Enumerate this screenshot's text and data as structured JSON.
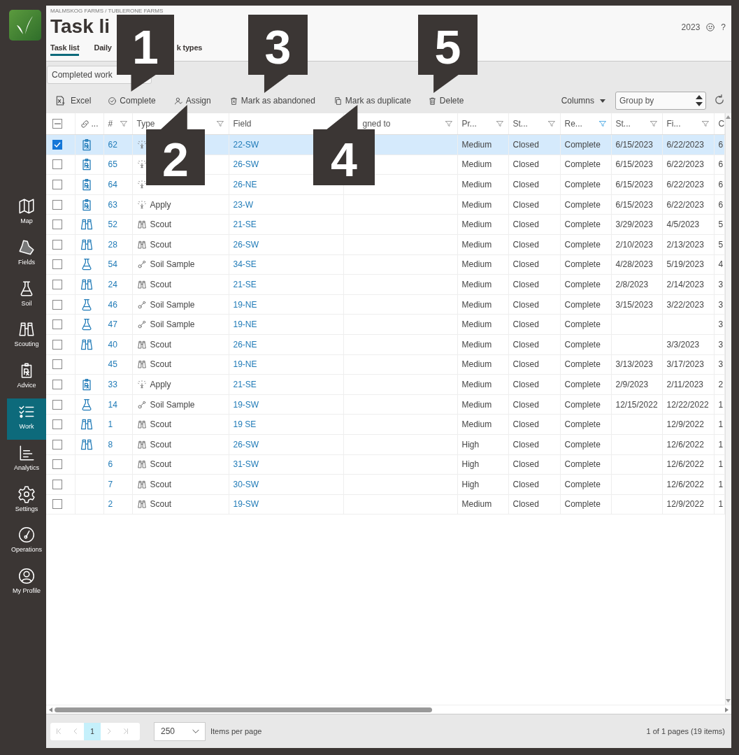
{
  "sidebar": {
    "items": [
      {
        "label": "Map",
        "kind": "map",
        "selected": false
      },
      {
        "label": "Fields",
        "kind": "fields",
        "selected": false
      },
      {
        "label": "Soil",
        "kind": "flask",
        "selected": false
      },
      {
        "label": "Scouting",
        "kind": "binoculars",
        "selected": false
      },
      {
        "label": "Advice",
        "kind": "rx",
        "selected": false
      },
      {
        "label": "Work",
        "kind": "checklist",
        "selected": true
      },
      {
        "label": "Analytics",
        "kind": "chart",
        "selected": false
      },
      {
        "label": "Settings",
        "kind": "gear",
        "selected": false
      },
      {
        "label": "Operations",
        "kind": "gauge",
        "selected": false
      },
      {
        "label": "My Profile",
        "kind": "profile",
        "selected": false
      }
    ]
  },
  "header": {
    "breadcrumb": "MALMSKOG FARMS / TUBLERONE FARMS",
    "title": "Task li",
    "year": "2023",
    "help": "?",
    "tabs": [
      {
        "label": "Task list",
        "selected": true
      },
      {
        "label": "Daily",
        "selected": false
      },
      {
        "label": "k types",
        "selected": false
      }
    ]
  },
  "view_select": {
    "value": "Completed work"
  },
  "toolbar": {
    "actions": [
      {
        "label": "Excel",
        "kind": "excel"
      },
      {
        "label": "Complete",
        "kind": "complete"
      },
      {
        "label": "Assign",
        "kind": "assign"
      },
      {
        "label": "Mark as abandoned",
        "kind": "abandon"
      },
      {
        "label": "Mark as duplicate",
        "kind": "duplicate"
      },
      {
        "label": "Delete",
        "kind": "delete"
      }
    ],
    "columns_menu": "Columns",
    "group_by": {
      "placeholder": "Group by"
    }
  },
  "table": {
    "select_all_partial": true,
    "columns": [
      {
        "label": "...",
        "kind": "link"
      },
      {
        "label": "#",
        "filter_active": false
      },
      {
        "label": "Type",
        "filter_active": false
      },
      {
        "label": "Field"
      },
      {
        "label": "gned to",
        "filter_active": false
      },
      {
        "label": "Pr...",
        "filter_active": false
      },
      {
        "label": "St...",
        "filter_active": false
      },
      {
        "label": "Re...",
        "filter_active": true
      },
      {
        "label": "St...",
        "filter_active": false
      },
      {
        "label": "Fi...",
        "filter_active": false
      },
      {
        "label": "C",
        "kind": "cut"
      }
    ],
    "rows": [
      {
        "selected": true,
        "link": {
          "kind": "rx"
        },
        "number": "62",
        "type": {
          "kind": "apply"
        },
        "field": "22-SW",
        "priority": "Medium",
        "status": "Closed",
        "result": "Complete",
        "start": "6/15/2023",
        "finish": "6/22/2023",
        "column_11": "6"
      },
      {
        "selected": false,
        "link": {
          "kind": "rx"
        },
        "number": "65",
        "type": {
          "kind": "apply"
        },
        "field": "26-SW",
        "priority": "Medium",
        "status": "Closed",
        "result": "Complete",
        "start": "6/15/2023",
        "finish": "6/22/2023",
        "column_11": "6"
      },
      {
        "selected": false,
        "link": {
          "kind": "rx"
        },
        "number": "64",
        "type": {
          "kind": "apply"
        },
        "field": "26-NE",
        "priority": "Medium",
        "status": "Closed",
        "result": "Complete",
        "start": "6/15/2023",
        "finish": "6/22/2023",
        "column_11": "6"
      },
      {
        "selected": false,
        "link": {
          "kind": "rx"
        },
        "number": "63",
        "type": {
          "kind": "apply",
          "label": "Apply"
        },
        "field": "23-W",
        "priority": "Medium",
        "status": "Closed",
        "result": "Complete",
        "start": "6/15/2023",
        "finish": "6/22/2023",
        "column_11": "6"
      },
      {
        "selected": false,
        "link": {
          "kind": "scouting"
        },
        "number": "52",
        "type": {
          "kind": "scout",
          "label": "Scout"
        },
        "field": "21-SE",
        "priority": "Medium",
        "status": "Closed",
        "result": "Complete",
        "start": "3/29/2023",
        "finish": "4/5/2023",
        "column_11": "5"
      },
      {
        "selected": false,
        "link": {
          "kind": "scouting"
        },
        "number": "28",
        "type": {
          "kind": "scout",
          "label": "Scout"
        },
        "field": "26-SW",
        "priority": "Medium",
        "status": "Closed",
        "result": "Complete",
        "start": "2/10/2023",
        "finish": "2/13/2023",
        "column_11": "5"
      },
      {
        "selected": false,
        "link": {
          "kind": "soil"
        },
        "number": "54",
        "type": {
          "kind": "sample",
          "label": "Soil Sample"
        },
        "field": "34-SE",
        "priority": "Medium",
        "status": "Closed",
        "result": "Complete",
        "start": "4/28/2023",
        "finish": "5/19/2023",
        "column_11": "4"
      },
      {
        "selected": false,
        "link": {
          "kind": "scouting"
        },
        "number": "24",
        "type": {
          "kind": "scout",
          "label": "Scout"
        },
        "field": "21-SE",
        "priority": "Medium",
        "status": "Closed",
        "result": "Complete",
        "start": "2/8/2023",
        "finish": "2/14/2023",
        "column_11": "3"
      },
      {
        "selected": false,
        "link": {
          "kind": "soil"
        },
        "number": "46",
        "type": {
          "kind": "sample",
          "label": "Soil Sample"
        },
        "field": "19-NE",
        "priority": "Medium",
        "status": "Closed",
        "result": "Complete",
        "start": "3/15/2023",
        "finish": "3/22/2023",
        "column_11": "3"
      },
      {
        "selected": false,
        "link": {
          "kind": "soil"
        },
        "number": "47",
        "type": {
          "kind": "sample",
          "label": "Soil Sample"
        },
        "field": "19-NE",
        "priority": "Medium",
        "status": "Closed",
        "result": "Complete",
        "column_11": "3"
      },
      {
        "selected": false,
        "link": {
          "kind": "scouting"
        },
        "number": "40",
        "type": {
          "kind": "scout",
          "label": "Scout"
        },
        "field": "26-NE",
        "priority": "Medium",
        "status": "Closed",
        "result": "Complete",
        "finish": "3/3/2023",
        "column_11": "3"
      },
      {
        "selected": false,
        "number": "45",
        "type": {
          "kind": "scout",
          "label": "Scout"
        },
        "field": "19-NE",
        "priority": "Medium",
        "status": "Closed",
        "result": "Complete",
        "start": "3/13/2023",
        "finish": "3/17/2023",
        "column_11": "3"
      },
      {
        "selected": false,
        "link": {
          "kind": "rx"
        },
        "number": "33",
        "type": {
          "kind": "apply",
          "label": "Apply"
        },
        "field": "21-SE",
        "priority": "Medium",
        "status": "Closed",
        "result": "Complete",
        "start": "2/9/2023",
        "finish": "2/11/2023",
        "column_11": "2"
      },
      {
        "selected": false,
        "link": {
          "kind": "soil"
        },
        "number": "14",
        "type": {
          "kind": "sample",
          "label": "Soil Sample"
        },
        "field": "19-SW",
        "priority": "Medium",
        "status": "Closed",
        "result": "Complete",
        "start": "12/15/2022",
        "finish": "12/22/2022",
        "column_11": "1"
      },
      {
        "selected": false,
        "link": {
          "kind": "scouting"
        },
        "number": "1",
        "type": {
          "kind": "scout",
          "label": "Scout"
        },
        "field": "19 SE",
        "priority": "Medium",
        "status": "Closed",
        "result": "Complete",
        "finish": "12/9/2022",
        "column_11": "1"
      },
      {
        "selected": false,
        "link": {
          "kind": "scouting"
        },
        "number": "8",
        "type": {
          "kind": "scout",
          "label": "Scout"
        },
        "field": "26-SW",
        "priority": "High",
        "status": "Closed",
        "result": "Complete",
        "finish": "12/6/2022",
        "column_11": "1"
      },
      {
        "selected": false,
        "number": "6",
        "type": {
          "kind": "scout",
          "label": "Scout"
        },
        "field": "31-SW",
        "priority": "High",
        "status": "Closed",
        "result": "Complete",
        "finish": "12/6/2022",
        "column_11": "1"
      },
      {
        "selected": false,
        "number": "7",
        "type": {
          "kind": "scout",
          "label": "Scout"
        },
        "field": "30-SW",
        "priority": "High",
        "status": "Closed",
        "result": "Complete",
        "finish": "12/6/2022",
        "column_11": "1"
      },
      {
        "selected": false,
        "number": "2",
        "type": {
          "kind": "scout",
          "label": "Scout"
        },
        "field": "19-SW",
        "priority": "Medium",
        "status": "Closed",
        "result": "Complete",
        "finish": "12/9/2022",
        "column_11": "1"
      }
    ]
  },
  "footer": {
    "pages": [
      {
        "label": "1",
        "selected": true
      }
    ],
    "page_size": "250",
    "page_size_label": "Items per page",
    "summary": "1 of 1 pages (19 items)"
  },
  "callouts": [
    {
      "number": "1",
      "kind": "down"
    },
    {
      "number": "2",
      "kind": "up"
    },
    {
      "number": "3",
      "kind": "down"
    },
    {
      "number": "4",
      "kind": "up"
    },
    {
      "number": "5",
      "kind": "down"
    }
  ]
}
